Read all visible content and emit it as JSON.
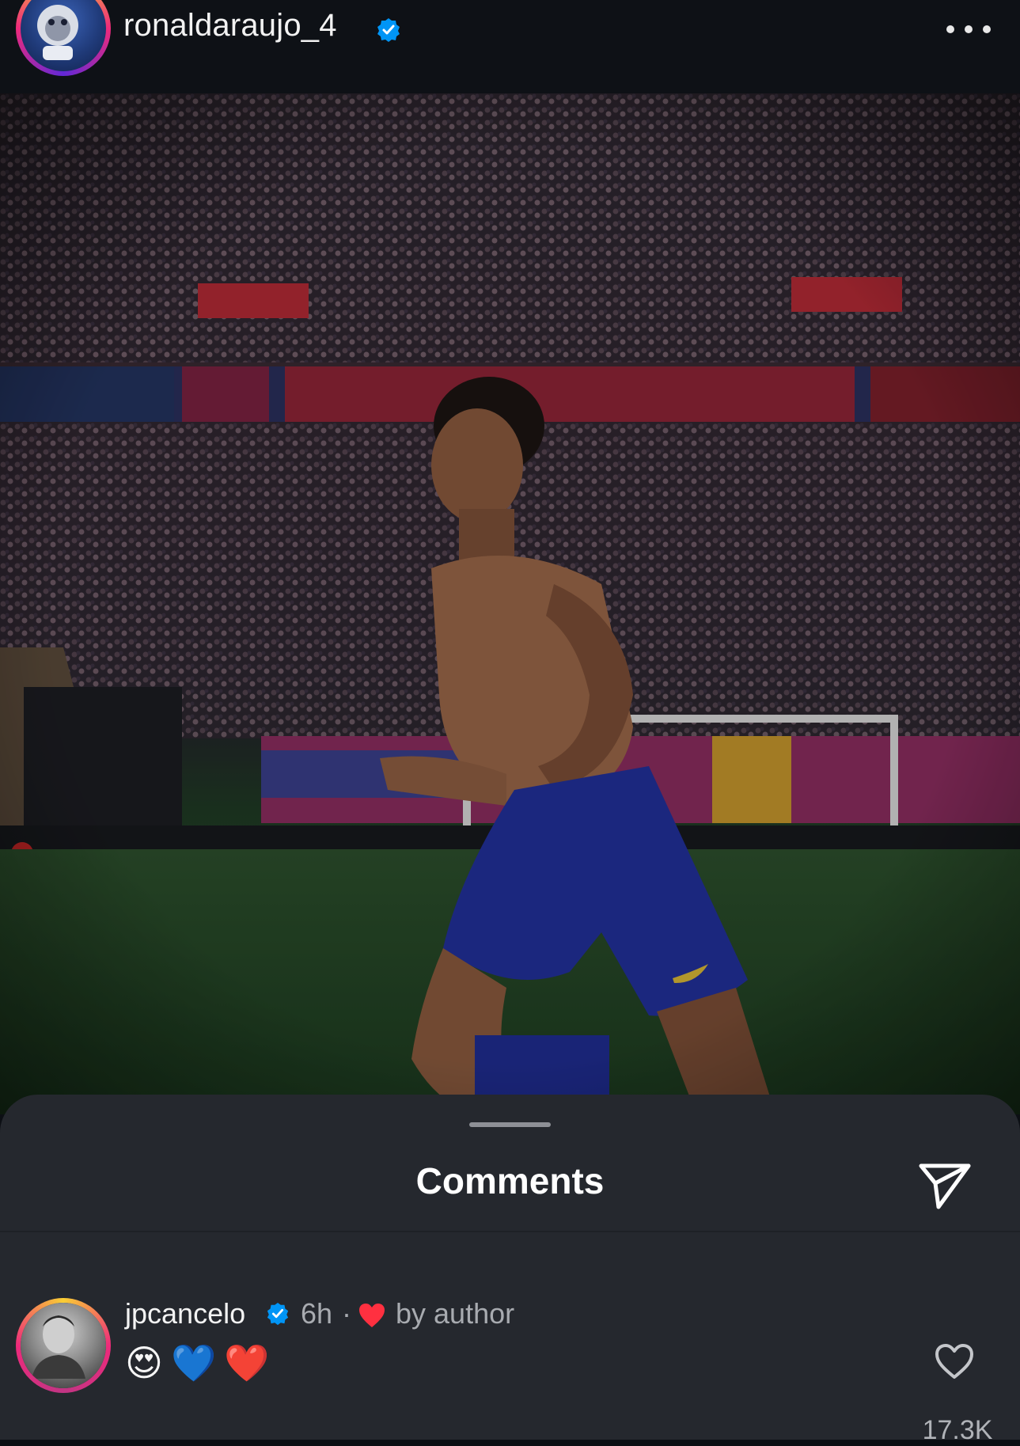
{
  "post": {
    "username": "ronaldaraujo_4",
    "verified": true,
    "more_icon": "more-horizontal-icon"
  },
  "comments_sheet": {
    "title": "Comments",
    "share_icon": "paper-plane-icon",
    "comments": [
      {
        "username": "jpcancelo",
        "verified": true,
        "time": "6h",
        "separator": "·",
        "liked_by_author_label": "by author",
        "text": "😍💙❤️",
        "like_count": "17.3K"
      }
    ]
  },
  "colors": {
    "verified_blue": "#0095f6",
    "heart_red": "#ff3040",
    "sheet_bg": "#25282e",
    "header_bg": "#0e1116"
  }
}
